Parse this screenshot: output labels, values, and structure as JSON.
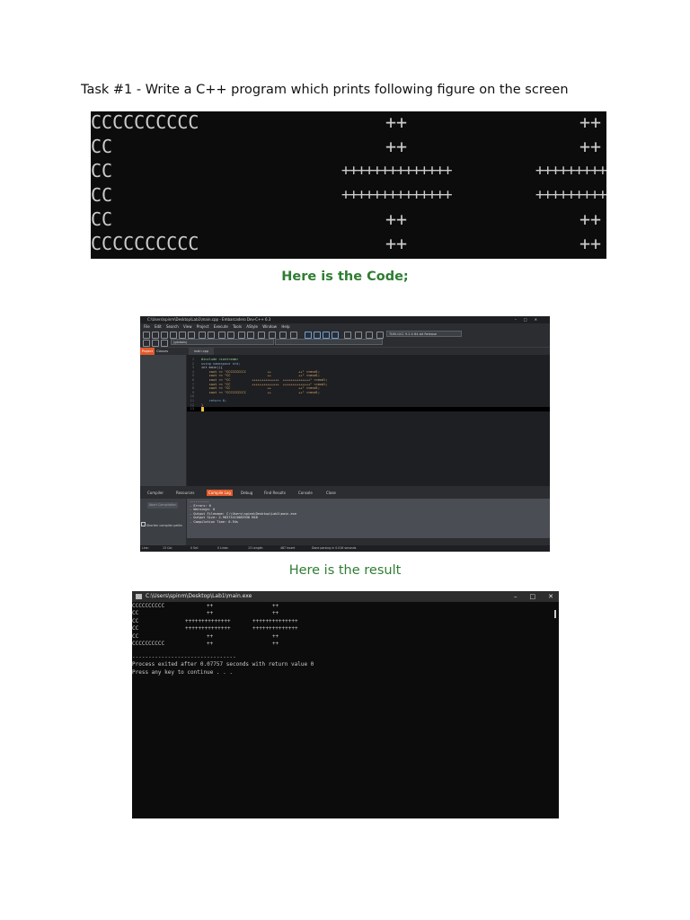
{
  "task_title": "Task #1 - Write a C++ program which prints following figure on the screen",
  "figure": {
    "rows": [
      [
        "CCCCCCCCCC",
        "++",
        "++"
      ],
      [
        "CC",
        "++",
        "++"
      ],
      [
        "CC",
        "++++++++++++++",
        "++++++++++++++"
      ],
      [
        "CC",
        "++++++++++++++",
        "++++++++++++++"
      ],
      [
        "CC",
        "++",
        "++"
      ],
      [
        "CCCCCCCCCC",
        "++",
        "++"
      ]
    ]
  },
  "code_heading": "Here is the Code;",
  "result_heading": "Here is the result",
  "ide": {
    "title": "C:\\Users\\spinm\\Desktop\\Lab1\\main.cpp - Embarcadero Dev-C++ 6.3",
    "menu": [
      "File",
      "Edit",
      "Search",
      "View",
      "Project",
      "Execute",
      "Tools",
      "AStyle",
      "Window",
      "Help"
    ],
    "compiler": "TDM-GCC 9.2.0 64-bit Release",
    "scope": "(globals)",
    "tabs": {
      "project": "Project",
      "classes": "Classes",
      "file": "main.cpp"
    },
    "code_lines": [
      {
        "n": "1",
        "t": "#include <iostream>"
      },
      {
        "n": "2",
        "t": "using namespace std;"
      },
      {
        "n": "3",
        "t": "int main(){"
      },
      {
        "n": "4",
        "t": "    cout << \"CCCCCCCCCC           ++              ++\" <<endl;"
      },
      {
        "n": "5",
        "t": "    cout << \"CC                   ++              ++\" <<endl;"
      },
      {
        "n": "6",
        "t": "    cout << \"CC           ++++++++++++++  ++++++++++++++\" <<endl;"
      },
      {
        "n": "7",
        "t": "    cout << \"CC           ++++++++++++++  ++++++++++++++\" <<endl;"
      },
      {
        "n": "8",
        "t": "    cout << \"CC                   ++              ++\" <<endl;"
      },
      {
        "n": "9",
        "t": "    cout << \"CCCCCCCCCC           ++              ++\" <<endl;"
      },
      {
        "n": "10",
        "t": ""
      },
      {
        "n": "11",
        "t": "    return 0;"
      },
      {
        "n": "12",
        "t": "}"
      },
      {
        "n": "13",
        "t": ""
      }
    ],
    "bottom_tabs": [
      "Compiler",
      "Resources",
      "Compile Log",
      "Debug",
      "Find Results",
      "Console",
      "Close"
    ],
    "abort_label": "Abort Compilation",
    "shorten_label": "Shorten compiler paths",
    "log_lines": [
      "----------",
      "- Errors: 0",
      "- Warnings: 0",
      "- Output Filename: C:\\Users\\spinm\\Desktop\\Lab1\\main.exe",
      "- Output Size: 2.98373413085938 MiB",
      "- Compilation Time: 0.94s"
    ],
    "status": {
      "line": "Line:",
      "col": "13 Col:",
      "sel": "0 Sel:",
      "lines": "0 Lines:",
      "length": "13 Length:",
      "insert": "487 Insert",
      "done": "Done parsing in 0.016 seconds"
    }
  },
  "console": {
    "title": "C:\\Users\\spinm\\Desktop\\Lab1\\main.exe",
    "rows": [
      [
        "CCCCCCCCCC",
        "++",
        "++"
      ],
      [
        "CC",
        "++",
        "++"
      ],
      [
        "CC",
        "++++++++++++++",
        "++++++++++++++"
      ],
      [
        "CC",
        "++++++++++++++",
        "++++++++++++++"
      ],
      [
        "CC",
        "++",
        "++"
      ],
      [
        "CCCCCCCCCC",
        "++",
        "++"
      ]
    ],
    "separator": "--------------------------------",
    "exit_line": "Process exited after 0.07757 seconds with return value 0",
    "press_line": "Press any key to continue . . ."
  },
  "colors": {
    "heading_green": "#2e7d32",
    "accent_orange": "#e25a2a"
  }
}
